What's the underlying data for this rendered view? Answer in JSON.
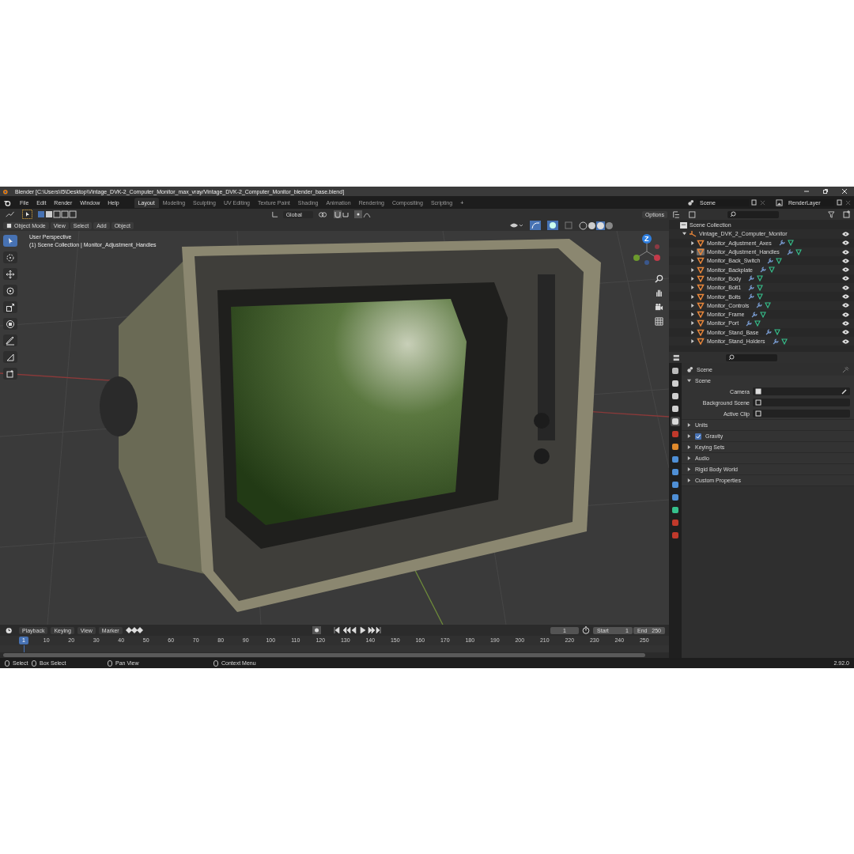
{
  "window": {
    "title": "Blender [C:\\Users\\I5\\Desktop\\Vintage_DVK-2_Computer_Monitor_max_vray/Vintage_DVK-2_Computer_Monitor_blender_base.blend]"
  },
  "menu": [
    "File",
    "Edit",
    "Render",
    "Window",
    "Help"
  ],
  "workspaces": [
    {
      "label": "Layout",
      "selected": true
    },
    {
      "label": "Modeling",
      "selected": false
    },
    {
      "label": "Sculpting",
      "selected": false
    },
    {
      "label": "UV Editing",
      "selected": false
    },
    {
      "label": "Texture Paint",
      "selected": false
    },
    {
      "label": "Shading",
      "selected": false
    },
    {
      "label": "Animation",
      "selected": false
    },
    {
      "label": "Rendering",
      "selected": false
    },
    {
      "label": "Compositing",
      "selected": false
    },
    {
      "label": "Scripting",
      "selected": false
    }
  ],
  "add_workspace": "+",
  "scene": {
    "value": "Scene"
  },
  "view_layer": {
    "value": "RenderLayer"
  },
  "viewport": {
    "orientation": "Global",
    "mode": "Object Mode",
    "menus": [
      "View",
      "Select",
      "Add",
      "Object"
    ],
    "options": "Options",
    "info": [
      "User Perspective",
      "(1) Scene Collection | Monitor_Adjustment_Handles"
    ],
    "gizmo_label": "Z",
    "tools": [
      {
        "kind": "select",
        "selected": true
      },
      {
        "kind": "cursor",
        "selected": false
      },
      {
        "kind": "move",
        "selected": false
      },
      {
        "kind": "rotate",
        "selected": false
      },
      {
        "kind": "scale",
        "selected": false
      },
      {
        "kind": "transform",
        "selected": false
      },
      {
        "kind": "annotate",
        "selected": false
      },
      {
        "kind": "measure",
        "selected": false
      },
      {
        "kind": "add_cube",
        "selected": false
      }
    ]
  },
  "outliner": {
    "root": "Scene Collection",
    "collection": {
      "label": "Vintage_DVK_2_Computer_Monitor",
      "expanded": true,
      "children": [
        {
          "label": "Monitor_Adjustment_Axes",
          "selected": false
        },
        {
          "label": "Monitor_Adjustment_Handles",
          "selected": true
        },
        {
          "label": "Monitor_Back_Switch",
          "selected": false
        },
        {
          "label": "Monitor_Backplate",
          "selected": false
        },
        {
          "label": "Monitor_Body",
          "selected": false
        },
        {
          "label": "Monitor_Bolt1",
          "selected": false
        },
        {
          "label": "Monitor_Bolts",
          "selected": false
        },
        {
          "label": "Monitor_Controls",
          "selected": false
        },
        {
          "label": "Monitor_Frame",
          "selected": false
        },
        {
          "label": "Monitor_Port",
          "selected": false
        },
        {
          "label": "Monitor_Stand_Base",
          "selected": false
        },
        {
          "label": "Monitor_Stand_Holders",
          "selected": false
        }
      ]
    }
  },
  "properties": {
    "tabs": [
      {
        "kind": "tool",
        "selected": false
      },
      {
        "kind": "render",
        "selected": false
      },
      {
        "kind": "output",
        "selected": false
      },
      {
        "kind": "view_layer",
        "selected": false
      },
      {
        "kind": "scene",
        "selected": true
      },
      {
        "kind": "world",
        "selected": false
      },
      {
        "kind": "object",
        "selected": false
      },
      {
        "kind": "modifier",
        "selected": false
      },
      {
        "kind": "particles",
        "selected": false
      },
      {
        "kind": "physics",
        "selected": false
      },
      {
        "kind": "constraints",
        "selected": false
      },
      {
        "kind": "data",
        "selected": false
      },
      {
        "kind": "material",
        "selected": false
      },
      {
        "kind": "texture",
        "selected": false
      }
    ],
    "title": "Scene",
    "panels": [
      {
        "label": "Scene",
        "expanded": true,
        "fields": [
          {
            "label": "Camera"
          },
          {
            "label": "Background Scene"
          },
          {
            "label": "Active Clip"
          }
        ]
      },
      {
        "label": "Units",
        "expanded": false
      },
      {
        "label": "Gravity",
        "expanded": false,
        "checked": true
      },
      {
        "label": "Keying Sets",
        "expanded": false
      },
      {
        "label": "Audio",
        "expanded": false
      },
      {
        "label": "Rigid Body World",
        "expanded": false
      },
      {
        "label": "Custom Properties",
        "expanded": false
      }
    ]
  },
  "timeline": {
    "menus": [
      "Playback",
      "Keying",
      "View",
      "Marker"
    ],
    "current_frame": "1",
    "start_label": "Start",
    "start": "1",
    "end_label": "End",
    "end": "250",
    "frame_marker": "1",
    "ruler": [
      "10",
      "20",
      "30",
      "40",
      "50",
      "60",
      "70",
      "80",
      "90",
      "100",
      "110",
      "120",
      "130",
      "140",
      "150",
      "160",
      "170",
      "180",
      "190",
      "200",
      "210",
      "220",
      "230",
      "240",
      "250"
    ]
  },
  "status_bar": {
    "items": [
      "Select",
      "Box Select",
      "Pan View",
      "Context Menu"
    ],
    "version": "2.92.0"
  }
}
